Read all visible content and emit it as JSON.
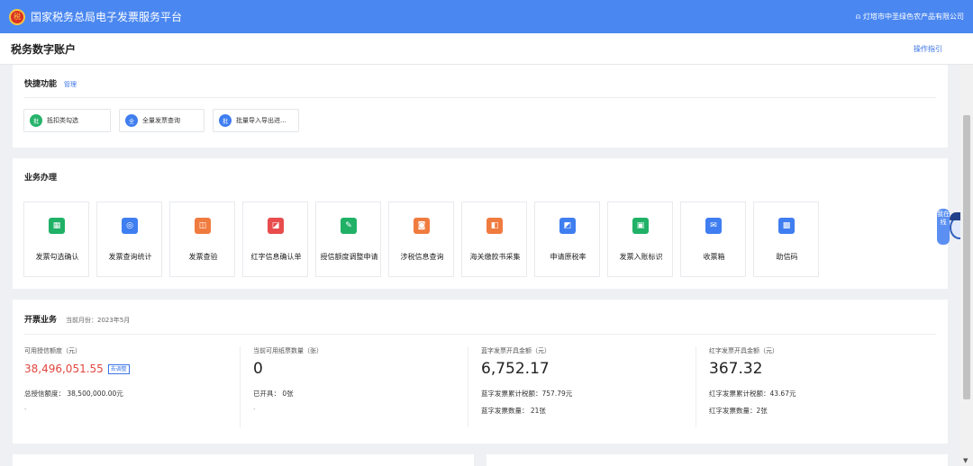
{
  "app": {
    "emblem_text": "税",
    "title": "国家税务总局电子发票服务平台",
    "user_icon": "person-icon",
    "user_glyph": "⍝",
    "company": "灯塔市中圣绿色农产品有限公司"
  },
  "subheader": {
    "title": "税务数字账户",
    "guide": "操作指引"
  },
  "quick": {
    "title": "快捷功能",
    "manage": "管理",
    "chips": [
      {
        "icon_text": "批",
        "label": "抵扣类勾选",
        "color": "#27b36b"
      },
      {
        "icon_text": "全",
        "label": "全量发票查询",
        "color": "#3f7ef0"
      },
      {
        "icon_text": "批",
        "label": "批量导入导出进…",
        "color": "#3f7ef0"
      }
    ]
  },
  "business": {
    "title": "业务办理",
    "tiles": [
      {
        "label": "发票勾选确认",
        "color": "#20b167",
        "glyph": "▦"
      },
      {
        "label": "发票查询统计",
        "color": "#3f7ef0",
        "glyph": "◎"
      },
      {
        "label": "发票查验",
        "color": "#f07b3f",
        "glyph": "◫"
      },
      {
        "label": "红字信息确认单",
        "color": "#e84c4c",
        "glyph": "◪"
      },
      {
        "label": "授信额度调整申请",
        "color": "#20b167",
        "glyph": "✎"
      },
      {
        "label": "涉税信息查询",
        "color": "#f07b3f",
        "glyph": "◙"
      },
      {
        "label": "海关缴款书采集",
        "color": "#f07b3f",
        "glyph": "◧"
      },
      {
        "label": "申请原税率",
        "color": "#3f7ef0",
        "glyph": "◩"
      },
      {
        "label": "发票入账标识",
        "color": "#20b167",
        "glyph": "▣"
      },
      {
        "label": "收票箱",
        "color": "#3f7ef0",
        "glyph": "✉"
      },
      {
        "label": "助信码",
        "color": "#3f7ef0",
        "glyph": "▩"
      }
    ]
  },
  "billing": {
    "title": "开票业务",
    "month": "当前月份：2023年5月",
    "available_credit_label": "可用授信额度（元）",
    "available_credit": "38,496,051.55",
    "adjust": "去调整",
    "total_credit": "总授信额度：  38,500,000.00元",
    "dash1": "-",
    "paper_label": "当前可用纸票数量（张）",
    "paper_count": "0",
    "issued": "已开具：  0张",
    "dash2": "-",
    "blue_label": "蓝字发票开具金额（元）",
    "blue_amount": "6,752.17",
    "blue_tax": "蓝字发票累计税额：757.79元",
    "blue_count": "蓝字发票数量：  21张",
    "red_label": "红字发票开具金额（元）",
    "red_amount": "367.32",
    "red_tax": "红字发票累计税额：43.67元",
    "red_count": "红字发票数量：2张"
  },
  "assistant": {
    "bubble": "我在线"
  }
}
